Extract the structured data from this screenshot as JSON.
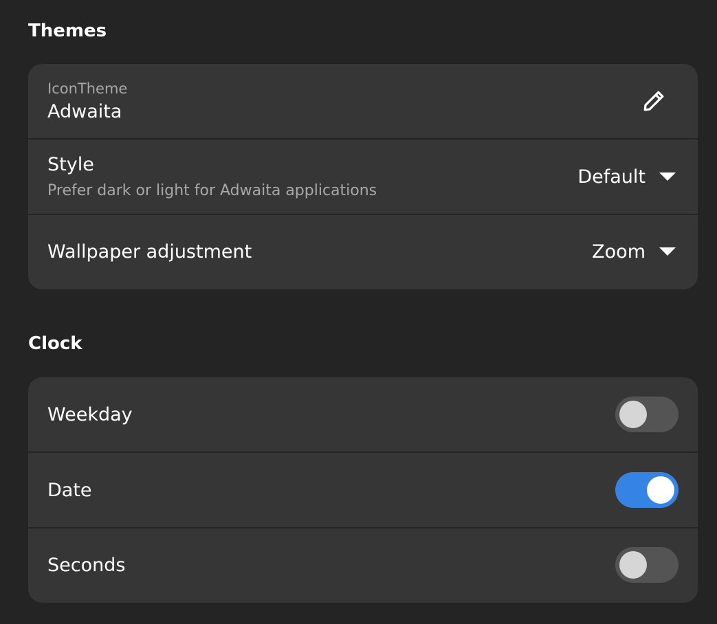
{
  "themes": {
    "title": "Themes",
    "icon_theme": {
      "label": "IconTheme",
      "value": "Adwaita",
      "icon": "pencil-icon"
    },
    "style": {
      "title": "Style",
      "subtitle": "Prefer dark or light for Adwaita applications",
      "value": "Default"
    },
    "wallpaper": {
      "title": "Wallpaper adjustment",
      "value": "Zoom"
    }
  },
  "clock": {
    "title": "Clock",
    "weekday": {
      "title": "Weekday",
      "enabled": false
    },
    "date": {
      "title": "Date",
      "enabled": true
    },
    "seconds": {
      "title": "Seconds",
      "enabled": false
    }
  },
  "colors": {
    "background": "#242424",
    "card": "#363636",
    "accent": "#3584e4",
    "switch_off": "#545454"
  }
}
